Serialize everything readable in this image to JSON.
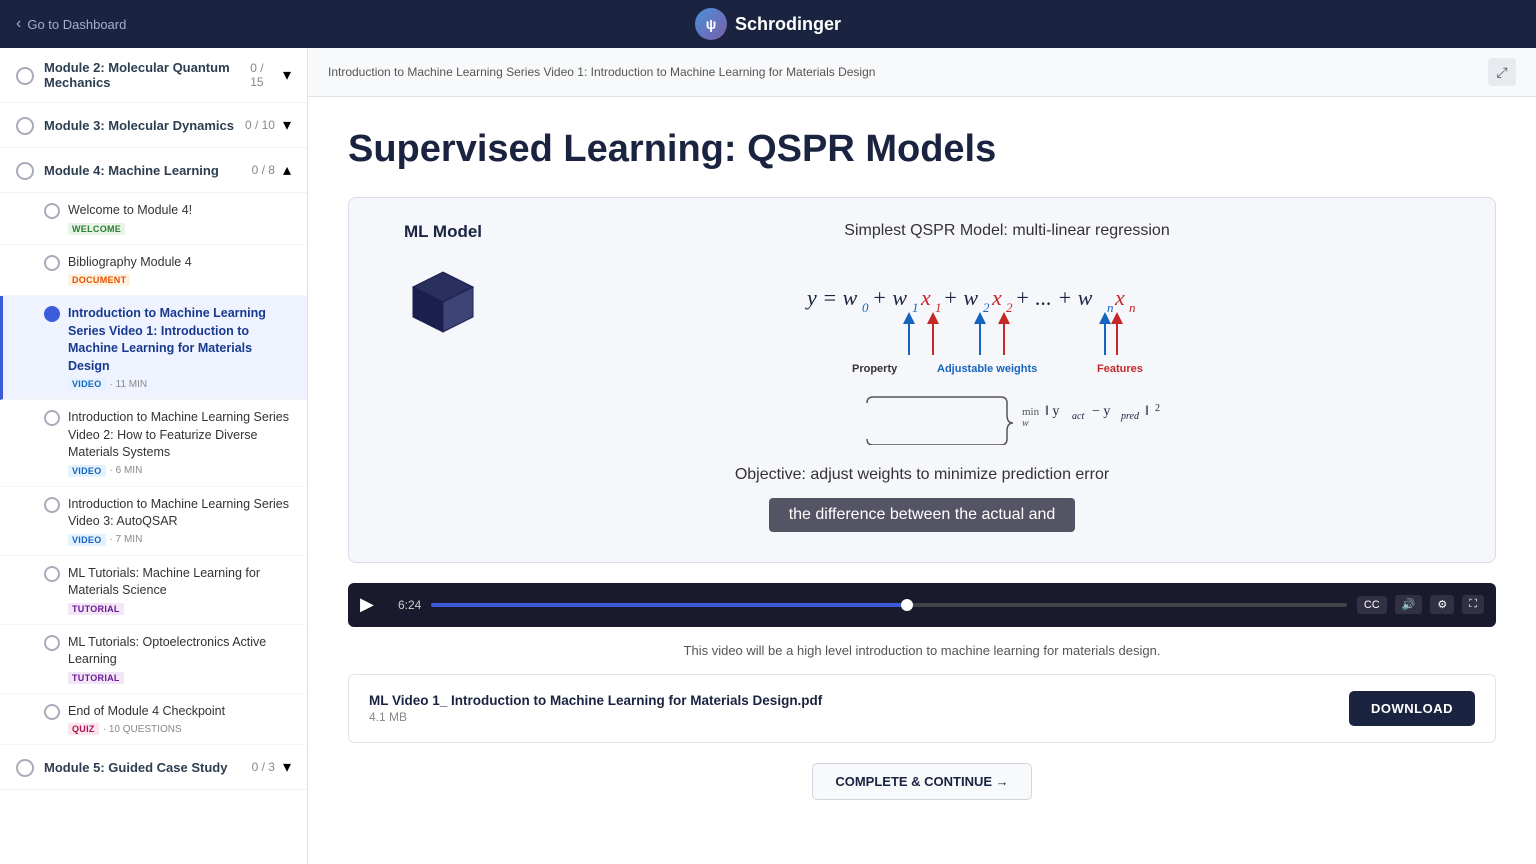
{
  "app": {
    "title": "Schrodinger",
    "back_label": "Go to Dashboard"
  },
  "breadcrumb": {
    "text": "Introduction to Machine Learning Series Video 1: Introduction to Machine Learning for Materials Design"
  },
  "slide": {
    "title": "Supervised Learning: QSPR Models",
    "ml_model_label": "ML Model",
    "qspr_subtitle": "Simplest QSPR Model: multi-linear regression",
    "formula_display": "y = w₀ + w₁x₁ + w₂x₂ + ... + wₙxₙ",
    "label_property": "Property",
    "label_weights": "Adjustable weights",
    "label_features": "Features",
    "min_formula": "min ‖ y_act - y_pred ‖²",
    "min_subscript": "w",
    "objective_text": "Objective: adjust weights to minimize prediction error",
    "caption": "the difference between the actual and"
  },
  "video": {
    "current_time": "6:24",
    "progress_percent": 52,
    "cc_label": "CC",
    "volume_icon": "volume",
    "settings_icon": "settings",
    "fullscreen_icon": "fullscreen"
  },
  "video_desc": "This video will be a high level introduction to machine learning for materials design.",
  "download": {
    "file_name": "ML Video 1_ Introduction to Machine Learning for Materials Design.pdf",
    "file_size": "4.1 MB",
    "button_label": "DOWNLOAD"
  },
  "complete_btn_label": "COMPLETE & CONTINUE →",
  "sidebar": {
    "modules": [
      {
        "id": "module2",
        "title": "Module 2: Molecular Quantum Mechanics",
        "count": "0 / 15",
        "expanded": false
      },
      {
        "id": "module3",
        "title": "Module 3: Molecular Dynamics",
        "count": "0 / 10",
        "expanded": false
      },
      {
        "id": "module4",
        "title": "Module 4: Machine Learning",
        "count": "0 / 8",
        "expanded": true
      }
    ],
    "module4_items": [
      {
        "id": "welcome",
        "title": "Welcome to Module 4!",
        "type": "WELCOME",
        "badge_class": "badge-welcome",
        "active": false
      },
      {
        "id": "bibliography",
        "title": "Bibliography Module 4",
        "type": "DOCUMENT",
        "badge_class": "badge-document",
        "active": false
      },
      {
        "id": "video1",
        "title": "Introduction to Machine Learning Series Video 1: Introduction to Machine Learning for Materials Design",
        "type": "VIDEO",
        "badge_class": "badge-video",
        "duration": "11 MIN",
        "active": true
      },
      {
        "id": "video2",
        "title": "Introduction to Machine Learning Series Video 2: How to Featurize Diverse Materials Systems",
        "type": "VIDEO",
        "badge_class": "badge-video",
        "duration": "6 MIN",
        "active": false
      },
      {
        "id": "video3",
        "title": "Introduction to Machine Learning Series Video 3: AutoQSAR",
        "type": "VIDEO",
        "badge_class": "badge-video",
        "duration": "7 MIN",
        "active": false
      },
      {
        "id": "tutorial1",
        "title": "ML Tutorials: Machine Learning for Materials Science",
        "type": "TUTORIAL",
        "badge_class": "badge-tutorial",
        "active": false
      },
      {
        "id": "tutorial2",
        "title": "ML Tutorials: Optoelectronics Active Learning",
        "type": "TUTORIAL",
        "badge_class": "badge-tutorial",
        "active": false
      },
      {
        "id": "quiz",
        "title": "End of Module 4 Checkpoint",
        "type": "QUIZ",
        "badge_class": "badge-quiz",
        "duration": "10 QUESTIONS",
        "active": false
      }
    ],
    "module5": {
      "title": "Module 5: Guided Case Study",
      "count": "0 / 3"
    }
  }
}
